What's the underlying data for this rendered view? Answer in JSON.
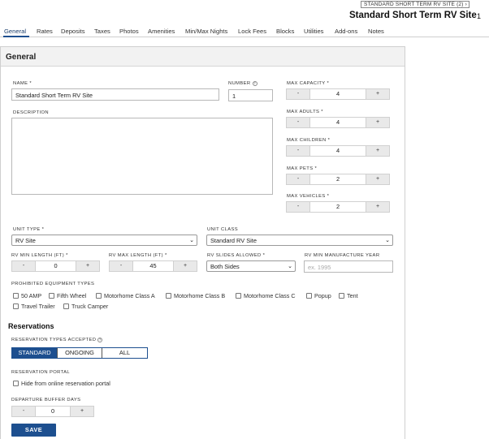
{
  "header": {
    "site_switcher": "STANDARD SHORT TERM RV SITE (2) ›",
    "title": "Standard Short Term RV Site",
    "title_count": "1"
  },
  "tabs": [
    {
      "label": "General"
    },
    {
      "label": "Rates"
    },
    {
      "label": "Deposits"
    },
    {
      "label": "Taxes"
    },
    {
      "label": "Photos"
    },
    {
      "label": "Amenities"
    },
    {
      "label": "Min/Max Nights"
    },
    {
      "label": "Lock Fees"
    },
    {
      "label": "Blocks"
    },
    {
      "label": "Utilities"
    },
    {
      "label": "Add-ons"
    },
    {
      "label": "Notes"
    }
  ],
  "panel": {
    "title": "General",
    "name_label": "NAME *",
    "name_value": "Standard Short Term RV Site",
    "number_label": "NUMBER",
    "number_value": "1",
    "description_label": "DESCRIPTION",
    "description_value": "",
    "capacity": [
      {
        "label": "MAX CAPACITY *",
        "value": "4"
      },
      {
        "label": "MAX ADULTS *",
        "value": "4"
      },
      {
        "label": "MAX CHILDREN *",
        "value": "4"
      },
      {
        "label": "MAX PETS *",
        "value": "2"
      },
      {
        "label": "MAX VEHICLES *",
        "value": "2"
      }
    ],
    "stepper_minus": "-",
    "stepper_plus": "+",
    "unit_type_label": "UNIT TYPE *",
    "unit_type_value": "RV Site",
    "unit_class_label": "UNIT CLASS",
    "unit_class_value": "Standard RV Site",
    "rv_min_label": "RV MIN LENGTH (FT) *",
    "rv_min_value": "0",
    "rv_max_label": "RV MAX LENGTH (FT) *",
    "rv_max_value": "45",
    "slides_label": "RV SLIDES ALLOWED *",
    "slides_value": "Both Sides",
    "manufacture_label": "RV MIN MANUFACTURE YEAR",
    "manufacture_placeholder": "ex. 1995",
    "prohibited_label": "PROHIBITED EQUIPMENT TYPES",
    "prohibited": [
      "50 AMP",
      "Fifth Wheel",
      "Motorhome Class A",
      "Motorhome Class B",
      "Motorhome Class C",
      "Popup",
      "Tent",
      "Travel Trailer",
      "Truck Camper"
    ]
  },
  "reservations": {
    "title": "Reservations",
    "types_label": "RESERVATION TYPES ACCEPTED",
    "types": [
      "STANDARD",
      "ONGOING",
      "ALL"
    ],
    "portal_label": "RESERVATION PORTAL",
    "hide_label": "Hide from online reservation portal",
    "buffer_label": "DEPARTURE BUFFER DAYS",
    "buffer_value": "0",
    "save_label": "SAVE"
  },
  "colors": {
    "accent": "#1d4f8f"
  }
}
